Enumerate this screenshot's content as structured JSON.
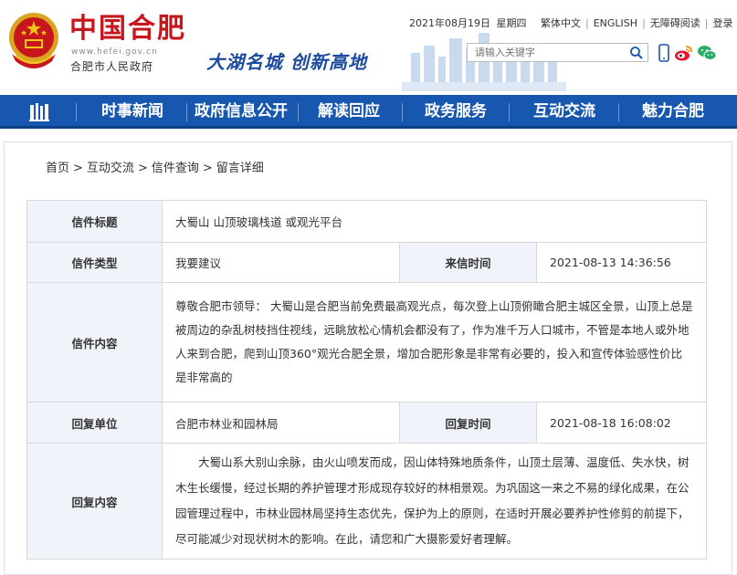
{
  "header": {
    "site_name": "中国合肥",
    "url": "www.hefei.gov.cn",
    "gov_name": "合肥市人民政府",
    "slogan": "大湖名城  创新高地",
    "date": "2021年08月19日",
    "weekday": "星期四",
    "top_links": [
      "繁体中文",
      "ENGLISH",
      "无障碍阅读",
      "登录"
    ],
    "search_placeholder": "请输入关键字",
    "brand_red": "#c8161d",
    "brand_blue": "#1757b0"
  },
  "nav": {
    "items": [
      "时事新闻",
      "政府信息公开",
      "解读回应",
      "政务服务",
      "互动交流",
      "魅力合肥"
    ]
  },
  "breadcrumb": [
    "首页",
    ">",
    "互动交流",
    ">",
    "信件查询",
    ">",
    "留言详细"
  ],
  "letter": {
    "title_label": "信件标题",
    "title": "大蜀山 山顶玻璃栈道 或观光平台",
    "type_label": "信件类型",
    "type": "我要建议",
    "received_label": "来信时间",
    "received": "2021-08-13 14:36:56",
    "content_label": "信件内容",
    "content": "尊敬合肥市领导： 大蜀山是合肥当前免费最高观光点，每次登上山顶俯瞰合肥主城区全景，山顶上总是被周边的杂乱树枝挡住视线，远眺放松心情机会都没有了，作为准千万人口城市，不管是本地人或外地人来到合肥，爬到山顶360°观光合肥全景，增加合肥形象是非常有必要的，投入和宣传体验感性价比是非常高的",
    "reply_unit_label": "回复单位",
    "reply_unit": "合肥市林业和园林局",
    "reply_time_label": "回复时间",
    "reply_time": "2021-08-18 16:08:02",
    "reply_content_label": "回复内容",
    "reply_content": "大蜀山系大别山余脉，由火山喷发而成，因山体特殊地质条件，山顶土层薄、温度低、失水快，树木生长缓慢，经过长期的养护管理才形成现存较好的林相景观。为巩固这一来之不易的绿化成果，在公园管理过程中，市林业园林局坚持生态优先，保护为上的原则，在适时开展必要养护性修剪的前提下，尽可能减少对现状树木的影响。在此，请您和广大摄影爱好者理解。"
  }
}
